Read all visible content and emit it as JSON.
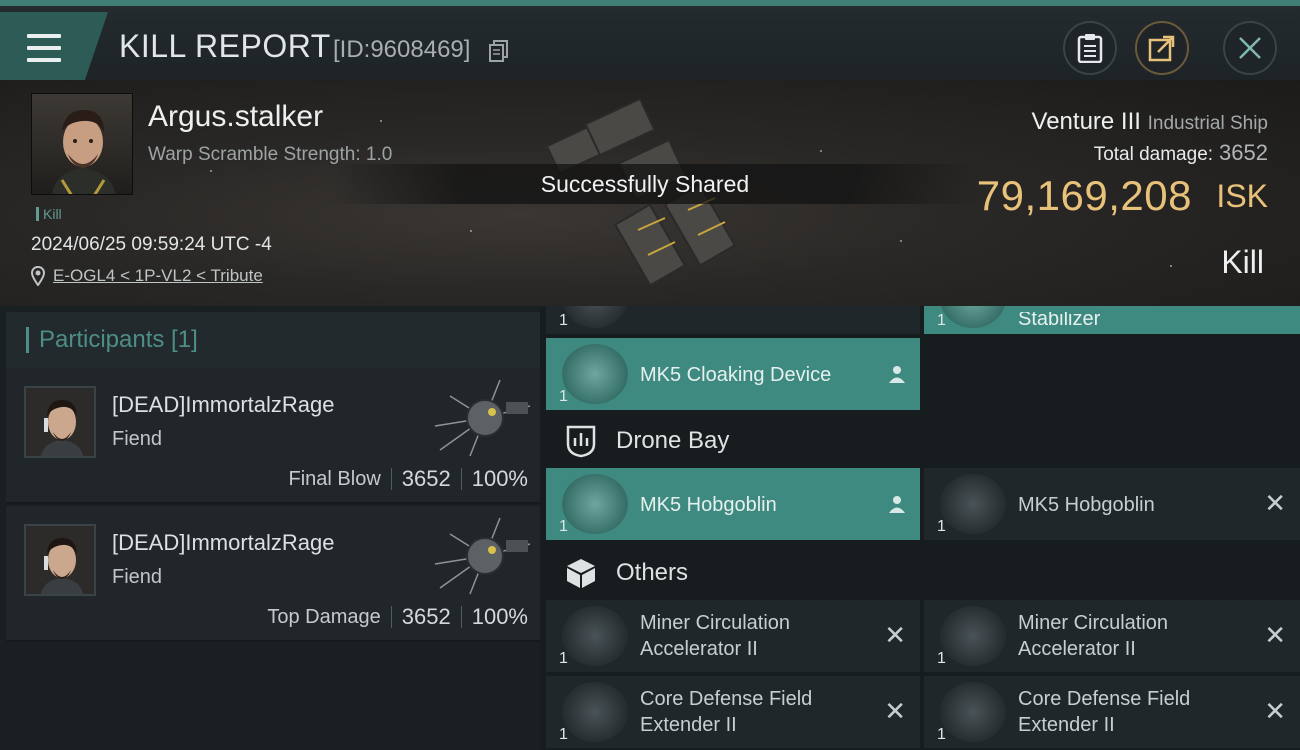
{
  "header": {
    "title": "KILL REPORT",
    "report_id": "[ID:9608469]"
  },
  "victim": {
    "pilot_name": "Argus.stalker",
    "warp_scramble": "Warp Scramble Strength: 1.0",
    "kill_tag": "Kill",
    "timestamp": "2024/06/25 09:59:24 UTC -4",
    "location": "E-OGL4 < 1P-VL2 < Tribute"
  },
  "toast": "Successfully Shared",
  "ship": {
    "name": "Venture III",
    "class": "Industrial Ship",
    "total_damage_label": "Total damage:",
    "total_damage_value": "3652",
    "isk_value": "79,169,208",
    "isk_unit": "ISK",
    "result": "Kill"
  },
  "participants": {
    "title": "Participants [1]",
    "list": [
      {
        "name": "[DEAD]ImmortalzRage",
        "ship": "Fiend",
        "role": "Final Blow",
        "damage": "3652",
        "percent": "100%"
      },
      {
        "name": "[DEAD]ImmortalzRage",
        "ship": "Fiend",
        "role": "Top Damage",
        "damage": "3652",
        "percent": "100%"
      }
    ]
  },
  "fitting": {
    "partial_top_left_qty": "1",
    "partial_top_right_qty": "1",
    "partial_top_right_name": "Stabilizer",
    "cloak": {
      "qty": "1",
      "name": "MK5 Cloaking Device"
    },
    "drone_bay_title": "Drone Bay",
    "drones": [
      {
        "qty": "1",
        "name": "MK5  Hobgoblin"
      },
      {
        "qty": "1",
        "name": "MK5  Hobgoblin"
      }
    ],
    "others_title": "Others",
    "others": [
      {
        "qty": "1",
        "line1": "Miner Circulation",
        "line2": "Accelerator II"
      },
      {
        "qty": "1",
        "line1": "Miner Circulation",
        "line2": "Accelerator II"
      },
      {
        "qty": "1",
        "line1": "Core Defense Field",
        "line2": "Extender II"
      },
      {
        "qty": "1",
        "line1": "Core Defense Field",
        "line2": "Extender II"
      }
    ]
  },
  "colors": {
    "accent": "#3f8a80",
    "isk": "#e8c27a",
    "background": "#15191c"
  }
}
